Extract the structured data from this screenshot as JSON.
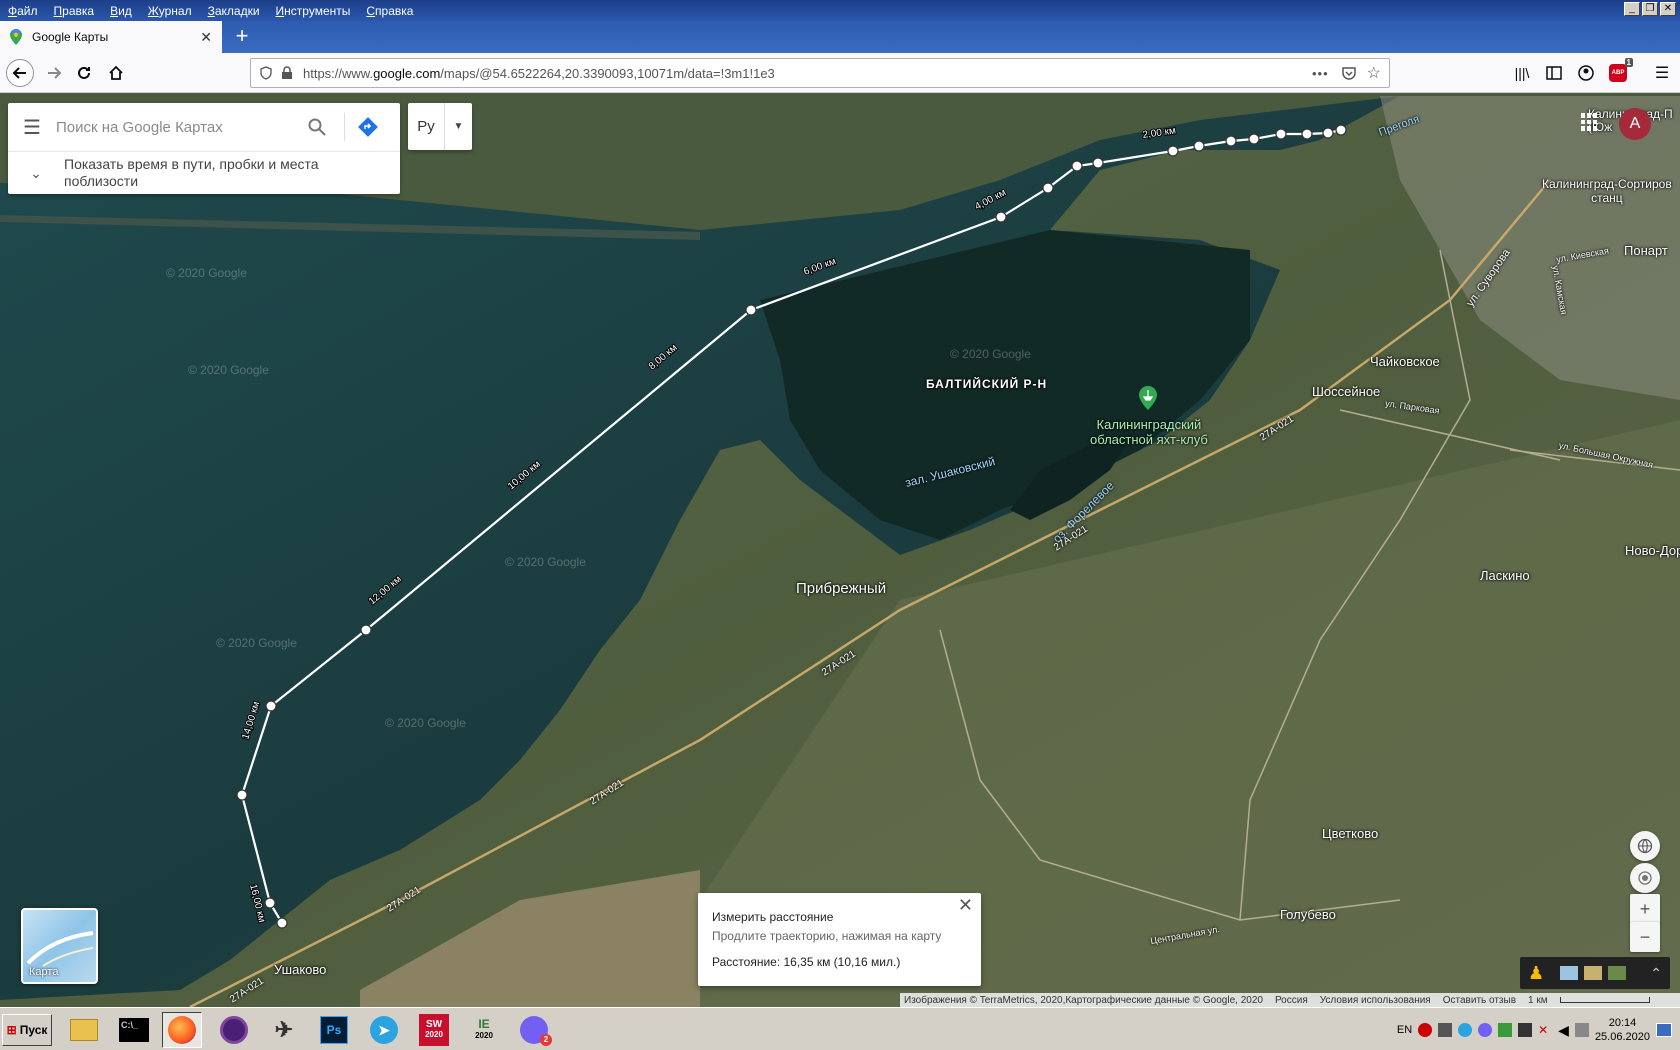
{
  "menu": [
    "Файл",
    "Правка",
    "Вид",
    "Журнал",
    "Закладки",
    "Инструменты",
    "Справка"
  ],
  "tab": {
    "title": "Google Карты",
    "close": "✕"
  },
  "url": {
    "prefix": "https://www.",
    "host": "google.com",
    "path": "/maps/@54.6522264,20.3390093,10071m/data=!3m1!1e3"
  },
  "toolbar_badges": {
    "abp": "ABP",
    "abp_count": "1"
  },
  "search": {
    "placeholder": "Поиск на Google Картах",
    "hint": "Показать время в пути, пробки и места поблизости"
  },
  "lang": {
    "label": "Ру"
  },
  "account": {
    "initial": "A"
  },
  "places": {
    "baltiysky": "БАЛТИЙСКИЙ Р-Н",
    "yacht1": "Калининградский",
    "yacht2": "областной яхт-клуб",
    "ushakovsky": "зал. Ушаковский",
    "forelevoe": "оз. Форелевое",
    "pribrezhny": "Прибрежный",
    "chaykovskoe": "Чайковское",
    "shosseynoe": "Шоссейное",
    "laskino": "Ласкино",
    "tsvetkovo": "Цветково",
    "golubevo": "Голубево",
    "ushakovo": "Ушаково",
    "ponart": "Понарт",
    "novodor": "Ново-Дор",
    "sortirov1": "Калининград-Сортиров",
    "sortirov2": "станц",
    "kaliningrad_top": "Калининград-П",
    "kaliningrad_top2": "(Юж",
    "pregolya": "Преголя",
    "ul_suvorova": "ул. Суворова",
    "ul_kievskaya": "ул. Киевская",
    "ul_kamskaya": "ул. Камская",
    "ul_parkovaya": "ул. Парковая",
    "ul_bolshaya": "ул. Большая Окружная",
    "ul_centralnaya": "Центральная ул.",
    "road1": "27А-021",
    "copyright": "© 2020 Google"
  },
  "route_labels": [
    "2,00 км",
    "4,00 км",
    "6,00 км",
    "8,00 км",
    "10,00 км",
    "12,00 км",
    "14,00 км",
    "16,00 км"
  ],
  "measure": {
    "title": "Измерить расстояние",
    "subtitle": "Продлите траекторию, нажимая на карту",
    "distance": "Расстояние: 16,35 км (10,16 мил.)",
    "close": "✕"
  },
  "layer": {
    "label": "Карта"
  },
  "footer": {
    "attribution": "Изображения © TerraMetrics, 2020,Картографические данные © Google, 2020",
    "country": "Россия",
    "terms": "Условия использования",
    "feedback": "Оставить отзыв",
    "scale": "1 км"
  },
  "taskbar": {
    "start": "Пуск",
    "lang": "EN",
    "time": "20:14",
    "date": "25.06.2020",
    "viber_badge": "2",
    "sw_label": "SW",
    "sw_year": "2020",
    "ie_label": "IE",
    "ie_year": "2020",
    "ps_label": "Ps"
  },
  "colors": {
    "route": "#ffffff",
    "accent": "#1a73e8",
    "menubar": "#2a57ad"
  }
}
